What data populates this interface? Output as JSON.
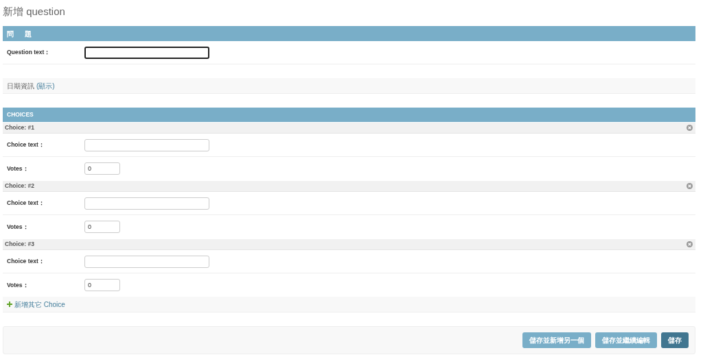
{
  "title": "新增 question",
  "question_section": {
    "heading": "問題",
    "fields": [
      {
        "label": "Question text：",
        "focused": true
      }
    ]
  },
  "date_section": {
    "label": "日期資訊",
    "toggle": "(顯示)"
  },
  "choices_section": {
    "heading": "CHOICES",
    "items": [
      {
        "title": "Choice: #1",
        "text_label": "Choice text：",
        "votes_label": "Votes：",
        "votes_value": "0"
      },
      {
        "title": "Choice: #2",
        "text_label": "Choice text：",
        "votes_label": "Votes：",
        "votes_value": "0"
      },
      {
        "title": "Choice: #3",
        "text_label": "Choice text：",
        "votes_label": "Votes：",
        "votes_value": "0"
      }
    ],
    "add_link": "新增其它 Choice"
  },
  "buttons": [
    {
      "label": "儲存並新增另一個",
      "kind": "secondary"
    },
    {
      "label": "儲存並繼續編輯",
      "kind": "secondary"
    },
    {
      "label": "儲存",
      "kind": "primary"
    }
  ]
}
